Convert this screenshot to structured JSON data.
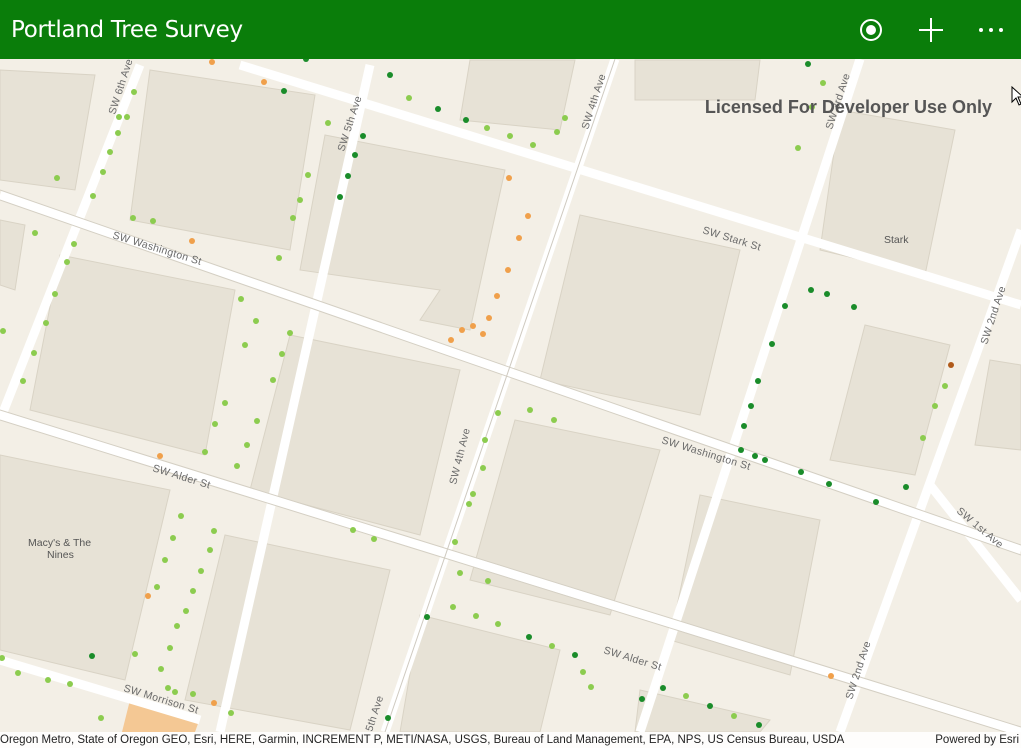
{
  "app": {
    "title": "Portland Tree Survey"
  },
  "toolbar": {
    "locate_icon": "locate-icon",
    "add_icon": "add-icon",
    "more_icon": "more-icon"
  },
  "map": {
    "watermark": "Licensed For Developer Use Only",
    "streets": {
      "sw_6th_ave": "SW 6th Ave",
      "sw_5th_ave": "SW 5th Ave",
      "sw_4th_ave_top": "SW 4th Ave",
      "sw_4th_ave_mid": "SW 4th Ave",
      "sw_3rd_ave_top": "SW 3rd Ave",
      "sw_2nd_ave_right": "SW 2nd Ave",
      "sw_2nd_ave_bottom": "SW 2nd Ave",
      "sw_1st_ave": "SW 1st Ave",
      "sw_stark_st": "SW Stark St",
      "sw_washington_st_left": "SW Washington St",
      "sw_washington_st_right": "SW Washington St",
      "sw_alder_st_left": "SW Alder St",
      "sw_alder_st_right": "SW Alder St",
      "sw_morrison_st": "SW Morrison St",
      "sw_5th_ave_bottom": "5th Ave"
    },
    "pois": {
      "stark": "Stark",
      "macys_line1": "Macy's & The",
      "macys_line2": "Nines"
    },
    "colors": {
      "background": "#f3efe6",
      "building": "#e7e2d6",
      "street": "#ffffff",
      "tree_light_green": "#8ccc4f",
      "tree_dark_green": "#1a8c2a",
      "tree_orange": "#f0a04b",
      "tree_brown": "#b05a1a",
      "app_bar": "#0a7d0a"
    }
  },
  "attribution": {
    "sources": "Oregon Metro, State of Oregon GEO, Esri, HERE, Garmin, INCREMENT P, METI/NASA, USGS, Bureau of Land Management, EPA, NPS, US Census Bureau, USDA",
    "powered_by": "Powered by Esri"
  }
}
